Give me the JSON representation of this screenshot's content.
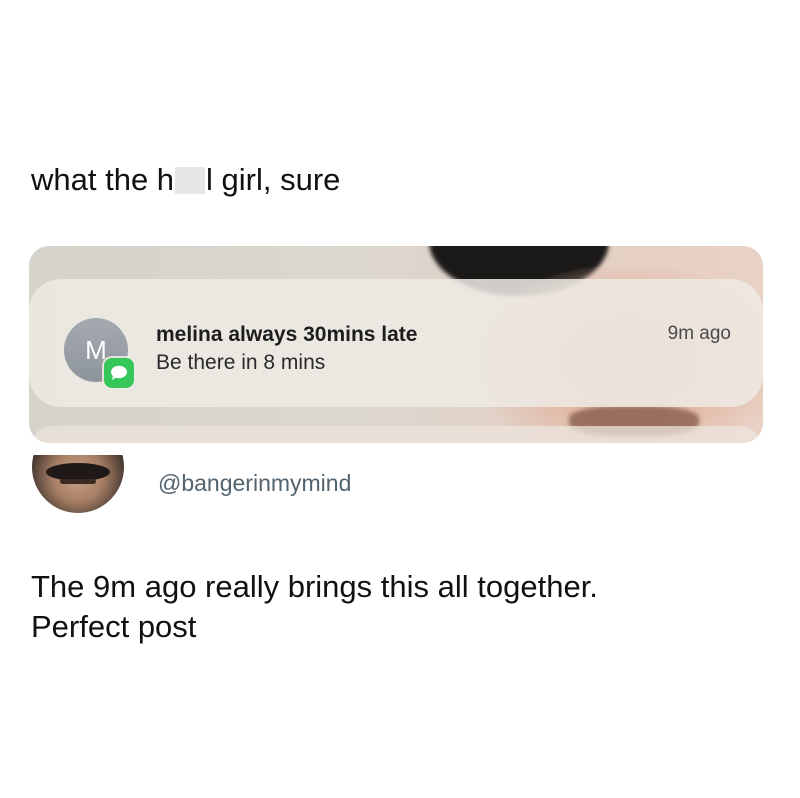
{
  "post": {
    "caption_part1": "what the h",
    "caption_part2": "l girl, sure"
  },
  "notification": {
    "avatar_initial": "M",
    "app_icon": "messages-icon",
    "title": "melina always 30mins late",
    "body": "Be there in 8 mins",
    "time": "9m ago"
  },
  "reply": {
    "handle": "@bangerinmymind",
    "line1": "The 9m ago really brings this all together.",
    "line2": "Perfect post"
  },
  "colors": {
    "messages_green": "#35c759",
    "handle_gray": "#536471"
  }
}
